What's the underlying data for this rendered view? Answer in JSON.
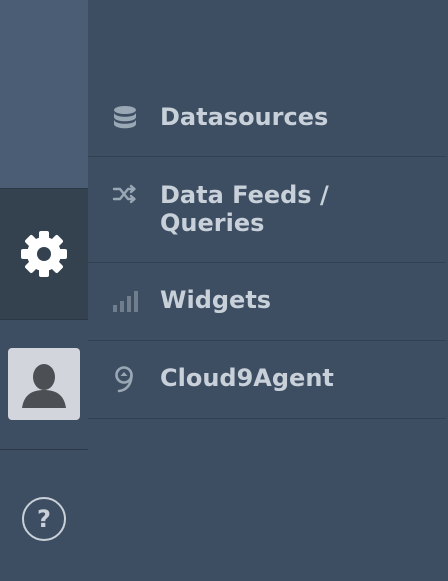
{
  "sidebar": {
    "items": [
      {
        "name": "settings",
        "icon": "gear-icon"
      },
      {
        "name": "user",
        "icon": "user-avatar-icon"
      },
      {
        "name": "help",
        "icon": "help-icon",
        "label": "?"
      }
    ]
  },
  "menu": {
    "items": [
      {
        "label": "Datasources",
        "icon": "database-icon"
      },
      {
        "label": "Data Feeds /\nQueries",
        "icon": "shuffle-icon"
      },
      {
        "label": "Widgets",
        "icon": "bar-chart-icon"
      },
      {
        "label": "Cloud9Agent",
        "icon": "cloud9-icon"
      }
    ]
  },
  "colors": {
    "rail_top": "#4a5d75",
    "rail_active": "#34414f",
    "panel": "#3e4e62",
    "text": "#c8d0d9",
    "icon": "#9aa7b5"
  }
}
